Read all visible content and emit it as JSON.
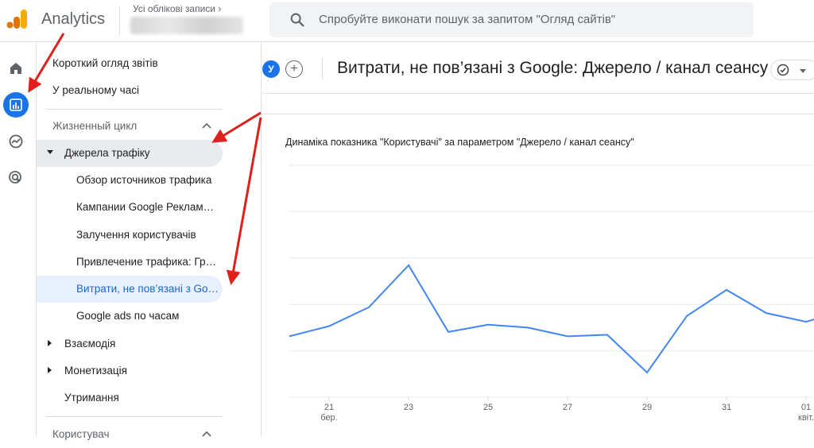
{
  "app": {
    "name": "Analytics"
  },
  "account": {
    "label": "Усі облікові записи"
  },
  "search": {
    "placeholder": "Спробуйте виконати пошук за запитом \"Огляд сайтів\""
  },
  "rail": {
    "items": [
      "home-icon",
      "reports-icon",
      "explore-icon",
      "advertising-icon"
    ]
  },
  "sidebar": {
    "top_items": [
      "Короткий огляд звітів",
      "У реальному часі"
    ],
    "section1": "Жизненный цикл",
    "traffic_group": "Джерела трафіку",
    "traffic_items": [
      "Обзор источников трафика",
      "Кампании Google Реклам…",
      "Залучення користувачів",
      "Привлечение трафика: Гр…",
      "Витрати, не пов’язані з Go…",
      "Google ads по часам"
    ],
    "groups": [
      "Взаємодія",
      "Монетизація",
      "Утримання"
    ],
    "section2": "Користувач"
  },
  "header": {
    "avatar": "У",
    "add": "+",
    "title": "Витрати, не пов’язані з Google: Джерело / канал сеансу"
  },
  "card": {
    "title": "Динаміка показника \"Користувачі\" за параметром \"Джерело / канал сеансу\""
  },
  "colors": {
    "accent": "#1a73e8",
    "line": "#4285f4",
    "arrow": "#e0201b"
  },
  "chart_data": {
    "type": "line",
    "x": [
      "20",
      "21",
      "22",
      "23",
      "24",
      "25",
      "26",
      "27",
      "28",
      "29",
      "30",
      "31",
      "01",
      "02"
    ],
    "tick_labels": [
      {
        "day": "21",
        "month": "бер."
      },
      {
        "day": "23",
        "month": ""
      },
      {
        "day": "25",
        "month": ""
      },
      {
        "day": "27",
        "month": ""
      },
      {
        "day": "29",
        "month": ""
      },
      {
        "day": "31",
        "month": ""
      },
      {
        "day": "01",
        "month": "квіт."
      }
    ],
    "series": [
      {
        "values": [
          4.2,
          4.9,
          6.2,
          9.1,
          4.5,
          5.0,
          4.8,
          4.2,
          4.3,
          1.7,
          5.6,
          7.4,
          5.8,
          5.2,
          6.0
        ]
      }
    ],
    "grid": true,
    "gridlines": 5
  }
}
